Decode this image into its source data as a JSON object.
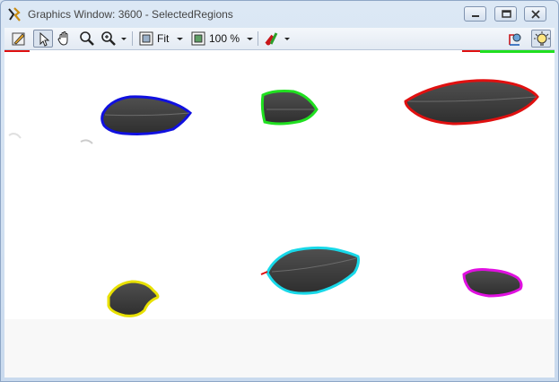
{
  "window": {
    "title": "Graphics Window: 3600 - SelectedRegions"
  },
  "toolbar": {
    "fit_label": "Fit",
    "zoom_label": "100 %"
  },
  "regions": [
    {
      "name": "region-blue",
      "color": "#1010e0"
    },
    {
      "name": "region-green",
      "color": "#20e020"
    },
    {
      "name": "region-red",
      "color": "#e01010"
    },
    {
      "name": "region-yellow",
      "color": "#e8e000"
    },
    {
      "name": "region-cyan",
      "color": "#18d8e8"
    },
    {
      "name": "region-magenta",
      "color": "#e010e0"
    }
  ]
}
